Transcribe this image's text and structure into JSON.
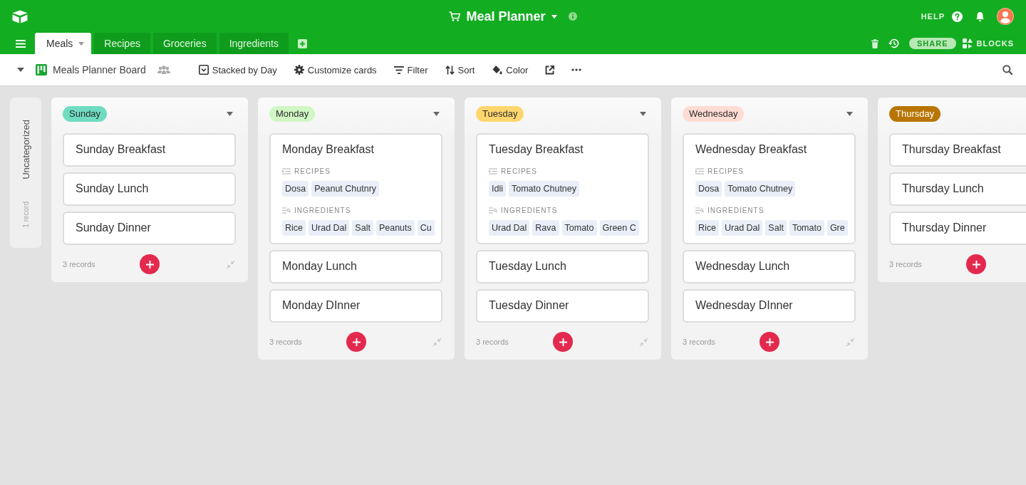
{
  "topbar": {
    "title": "Meal Planner",
    "help": "HELP"
  },
  "tabs": [
    {
      "label": "Meals",
      "selected": true
    },
    {
      "label": "Recipes",
      "selected": false
    },
    {
      "label": "Groceries",
      "selected": false
    },
    {
      "label": "Ingredients",
      "selected": false
    }
  ],
  "actions": {
    "share": "SHARE",
    "blocks": "BLOCKS"
  },
  "view": {
    "name": "Meals Planner Board",
    "tools": [
      {
        "kind": "stacked",
        "label": "Stacked by Day"
      },
      {
        "kind": "customize",
        "label": "Customize cards"
      },
      {
        "kind": "filter",
        "label": "Filter"
      },
      {
        "kind": "sort",
        "label": "Sort"
      },
      {
        "kind": "color",
        "label": "Color"
      }
    ]
  },
  "uncategorized": {
    "label": "Uncategorized",
    "count": "1 record"
  },
  "columns": [
    {
      "name": "Sunday",
      "color": "#6fdcc1",
      "cut_off": false,
      "count": "3 records",
      "cards": [
        {
          "title": "Sunday Breakfast"
        },
        {
          "title": "Sunday Lunch"
        },
        {
          "title": "Sunday Dinner"
        }
      ]
    },
    {
      "name": "Monday",
      "color": "#d1f7c4",
      "cut_off": false,
      "count": "3 records",
      "cards": [
        {
          "title": "Monday Breakfast",
          "fields": [
            {
              "kind": "recipes",
              "label": "RECIPES",
              "values": [
                "Dosa",
                "Peanut Chutnry"
              ]
            },
            {
              "kind": "ingredients",
              "label": "INGREDIENTS",
              "values": [
                "Rice",
                "Urad Dal",
                "Salt",
                "Peanuts",
                "Cu"
              ]
            }
          ]
        },
        {
          "title": "Monday Lunch"
        },
        {
          "title": "Monday DInner"
        }
      ]
    },
    {
      "name": "Tuesday",
      "color": "#ffd66e",
      "cut_off": false,
      "count": "3 records",
      "cards": [
        {
          "title": "Tuesday Breakfast",
          "fields": [
            {
              "kind": "recipes",
              "label": "RECIPES",
              "values": [
                "Idli",
                "Tomato Chutney"
              ]
            },
            {
              "kind": "ingredients",
              "label": "INGREDIENTS",
              "values": [
                "Urad Dal",
                "Rava",
                "Tomato",
                "Green C"
              ]
            }
          ]
        },
        {
          "title": "Tuesday Lunch"
        },
        {
          "title": "Tuesday Dinner"
        }
      ]
    },
    {
      "name": "Wednesday",
      "color": "#ffdcd3",
      "cut_off": false,
      "count": "3 records",
      "cards": [
        {
          "title": "Wednesday Breakfast",
          "fields": [
            {
              "kind": "recipes",
              "label": "RECIPES",
              "values": [
                "Dosa",
                "Tomato Chutney"
              ]
            },
            {
              "kind": "ingredients",
              "label": "INGREDIENTS",
              "values": [
                "Rice",
                "Urad Dal",
                "Salt",
                "Tomato",
                "Gre"
              ]
            }
          ]
        },
        {
          "title": "Wednesday Lunch"
        },
        {
          "title": "Wednesday DInner"
        }
      ]
    },
    {
      "name": "Thursday",
      "color": "#b87503",
      "cut_off": true,
      "count": "3 records",
      "cards": [
        {
          "title": "Thursday Breakfast"
        },
        {
          "title": "Thursday Lunch"
        },
        {
          "title": "Thursday Dinner"
        }
      ]
    }
  ]
}
